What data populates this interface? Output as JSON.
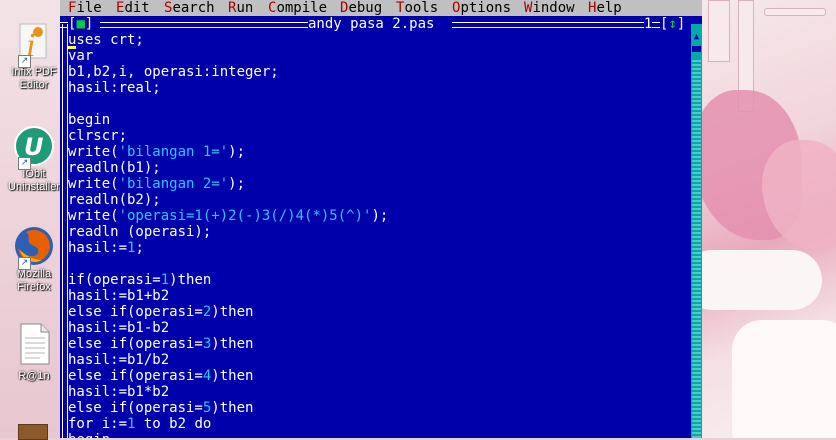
{
  "desktop": {
    "icons": [
      {
        "label": "Infix PDF Editor",
        "icon": "infix-pdf-icon",
        "color": "#e8931d"
      },
      {
        "label": "IObit Uninstaller",
        "icon": "iobit-uninstaller-icon",
        "color": "#1f9b7a"
      },
      {
        "label": "Mozilla Firefox",
        "icon": "firefox-icon",
        "color": "#e66000"
      },
      {
        "label": "R@1n",
        "icon": "document-icon",
        "color": "#ffffff"
      }
    ]
  },
  "menubar": {
    "items": [
      {
        "hot": "F",
        "rest": "ile"
      },
      {
        "hot": "E",
        "rest": "dit"
      },
      {
        "hot": "S",
        "rest": "earch"
      },
      {
        "hot": "R",
        "rest": "un"
      },
      {
        "hot": "C",
        "rest": "ompile"
      },
      {
        "hot": "D",
        "rest": "ebug"
      },
      {
        "hot": "T",
        "rest": "ools"
      },
      {
        "hot": "O",
        "rest": "ptions"
      },
      {
        "hot": "W",
        "rest": "indow"
      },
      {
        "hot": "H",
        "rest": "elp"
      }
    ]
  },
  "window": {
    "close_glyph": "[■]",
    "title": " andy pasa 2.pas ",
    "number": "1",
    "zoom_glyph": "[↕]"
  },
  "code": [
    [
      {
        "t": "uses crt;"
      }
    ],
    [
      {
        "t": "var"
      }
    ],
    [
      {
        "t": "b1,b2,i, operasi:integer;"
      }
    ],
    [
      {
        "t": "hasil:real;"
      }
    ],
    [
      {
        "t": ""
      }
    ],
    [
      {
        "t": "begin"
      }
    ],
    [
      {
        "t": "clrscr;"
      }
    ],
    [
      {
        "t": "write("
      },
      {
        "t": "'bilangan 1='",
        "c": "str"
      },
      {
        "t": ");"
      }
    ],
    [
      {
        "t": "readln(b1);"
      }
    ],
    [
      {
        "t": "write("
      },
      {
        "t": "'bilangan 2='",
        "c": "str"
      },
      {
        "t": ");"
      }
    ],
    [
      {
        "t": "readln(b2);"
      }
    ],
    [
      {
        "t": "write("
      },
      {
        "t": "'operasi=1(+)2(-)3(/)4(*)5(^)'",
        "c": "str"
      },
      {
        "t": ");"
      }
    ],
    [
      {
        "t": "readln (operasi);"
      }
    ],
    [
      {
        "t": "hasil:="
      },
      {
        "t": "1",
        "c": "str"
      },
      {
        "t": ";"
      }
    ],
    [
      {
        "t": ""
      }
    ],
    [
      {
        "t": "if(operasi="
      },
      {
        "t": "1",
        "c": "str"
      },
      {
        "t": ")then"
      }
    ],
    [
      {
        "t": "hasil:=b1+b2"
      }
    ],
    [
      {
        "t": "else if(operasi="
      },
      {
        "t": "2",
        "c": "str"
      },
      {
        "t": ")then"
      }
    ],
    [
      {
        "t": "hasil:=b1-b2"
      }
    ],
    [
      {
        "t": "else if(operasi="
      },
      {
        "t": "3",
        "c": "str"
      },
      {
        "t": ")then"
      }
    ],
    [
      {
        "t": "hasil:=b1/b2"
      }
    ],
    [
      {
        "t": "else if(operasi="
      },
      {
        "t": "4",
        "c": "str"
      },
      {
        "t": ")then"
      }
    ],
    [
      {
        "t": "hasil:=b1*b2"
      }
    ],
    [
      {
        "t": "else if(operasi="
      },
      {
        "t": "5",
        "c": "str"
      },
      {
        "t": ")then"
      }
    ],
    [
      {
        "t": "for i:="
      },
      {
        "t": "1",
        "c": "str"
      },
      {
        "t": " to b2 do"
      }
    ],
    [
      {
        "t": "begin"
      }
    ]
  ],
  "colors": {
    "editor_bg": "#0000aa",
    "menubar_bg": "#c0c0c0",
    "hotkey": "#aa0000",
    "literal": "#29c9ff",
    "scrollbar": "#00aaaa"
  }
}
